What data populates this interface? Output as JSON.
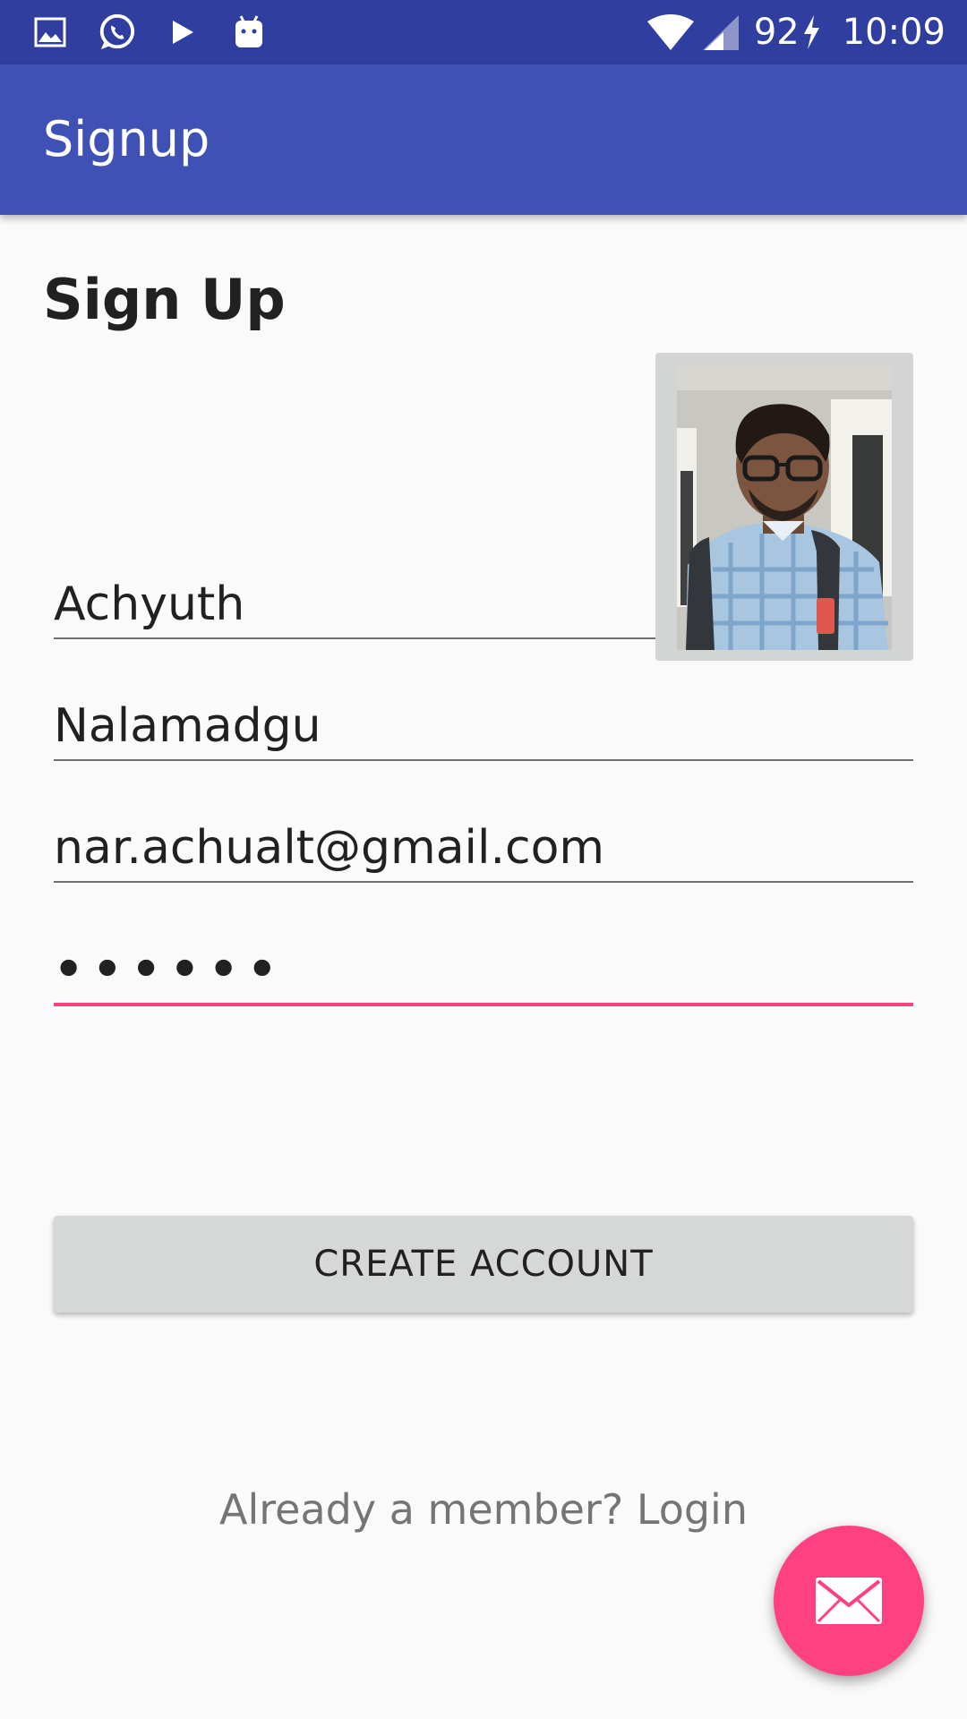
{
  "status_bar": {
    "battery": "92",
    "time": "10:09",
    "icons": [
      "gallery-icon",
      "whatsapp-icon",
      "play-store-icon",
      "android-icon",
      "wifi-icon",
      "cell-signal-icon",
      "charging-icon"
    ]
  },
  "app_bar": {
    "title": "Signup"
  },
  "page": {
    "heading": "Sign Up"
  },
  "form": {
    "first_name": "Achyuth",
    "last_name": "Nalamadgu",
    "email": "nar.achualt@gmail.com",
    "password_mask": "••••••"
  },
  "actions": {
    "create_account_label": "CREATE ACCOUNT",
    "login_prompt": "Already a member? Login",
    "fab_icon": "mail-icon"
  },
  "colors": {
    "status_bar": "#303f9f",
    "app_bar": "#3f51b5",
    "accent": "#ff4081",
    "background": "#fafafa"
  }
}
